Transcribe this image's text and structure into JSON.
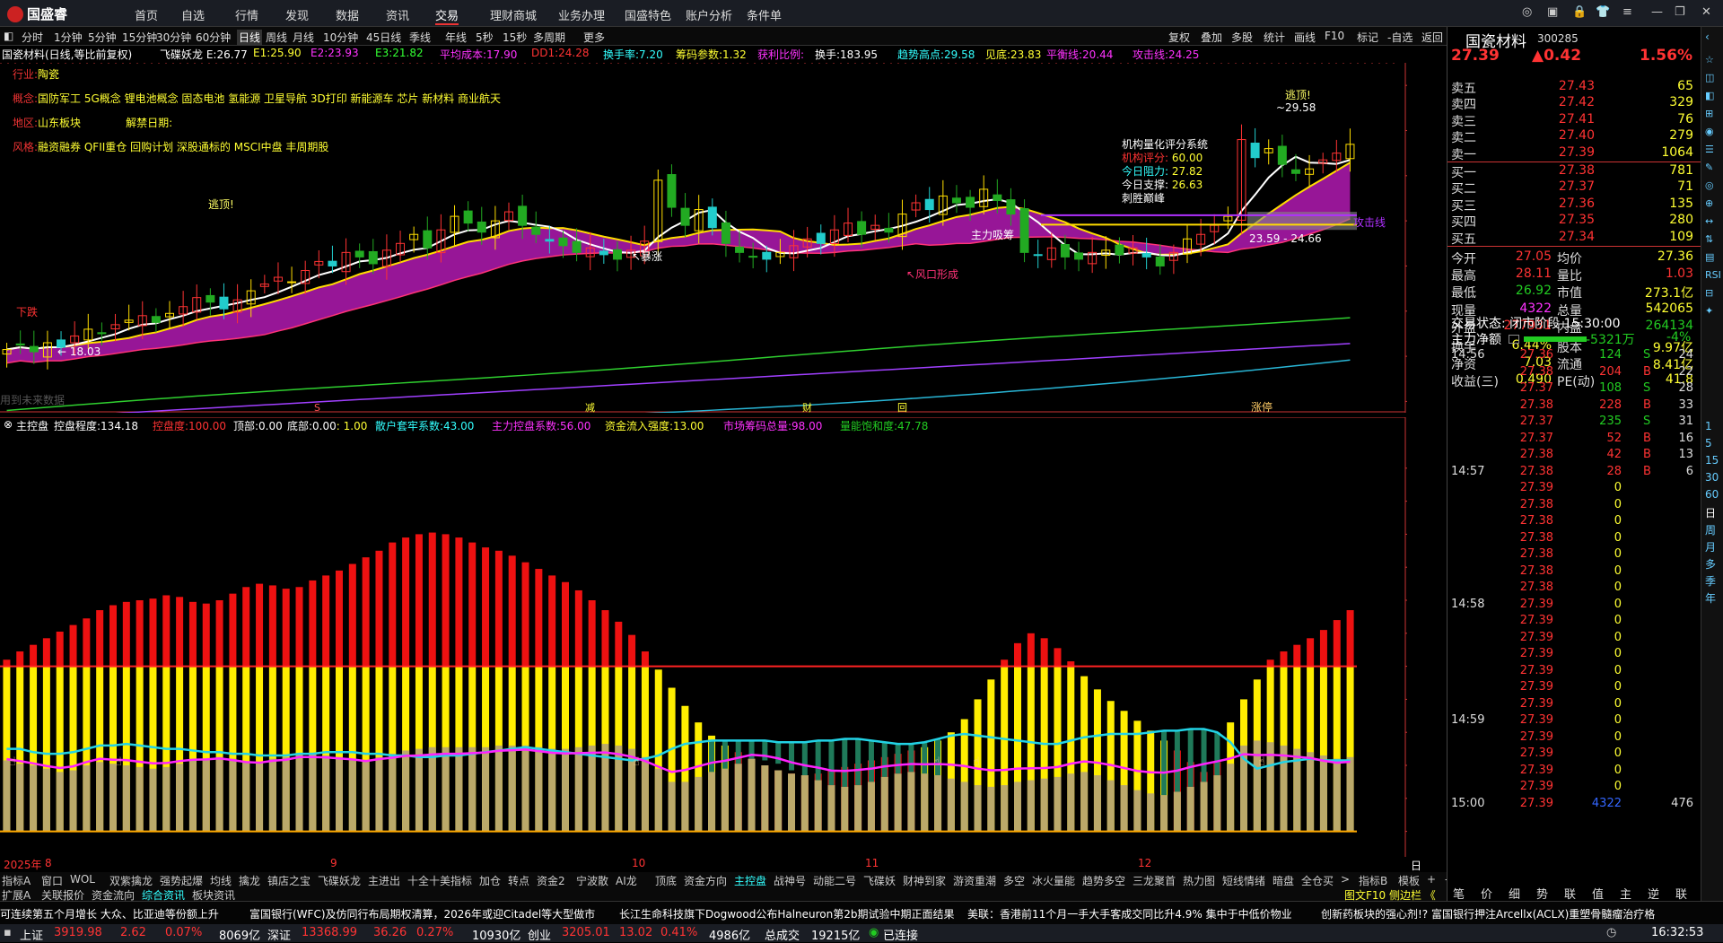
{
  "app": {
    "logo": "国盛睿"
  },
  "menu": [
    "首页",
    "自选",
    "行情",
    "发现",
    "数据",
    "资讯",
    "交易",
    "理财商城",
    "业务办理",
    "国盛特色",
    "账户分析",
    "条件单"
  ],
  "menu_active": "交易",
  "periods": [
    "分时",
    "1分钟",
    "5分钟",
    "15分钟",
    "30分钟",
    "60分钟",
    "日线",
    "周线",
    "月线",
    "10分钟",
    "45日线",
    "季线",
    "年线",
    "5秒",
    "15秒",
    "多周期",
    "更多"
  ],
  "period_active": "日线",
  "right_tools": [
    "复权",
    "叠加",
    "多股",
    "统计",
    "画线",
    "F10",
    "标记",
    "-自选",
    "返回"
  ],
  "kline_info": [
    {
      "t": "国瓷材料(日线,等比前复权)",
      "c": "#fff"
    },
    {
      "t": "飞碟妖龙 E:26.77",
      "c": "#fff"
    },
    {
      "t": "E1:25.90",
      "c": "#ff3"
    },
    {
      "t": "E2:23.93",
      "c": "#f3f"
    },
    {
      "t": "E3:21.82",
      "c": "#3f3"
    },
    {
      "t": "平均成本:17.90",
      "c": "#f3f"
    },
    {
      "t": "DD1:24.28",
      "c": "#f33"
    },
    {
      "t": "换手率:7.20",
      "c": "#3ff"
    },
    {
      "t": "筹码参数:1.32",
      "c": "#ff3"
    },
    {
      "t": "获利比例:",
      "c": "#f3f"
    },
    {
      "t": "换手:183.95",
      "c": "#fff"
    },
    {
      "t": "趋势高点:29.58",
      "c": "#3ff"
    },
    {
      "t": "见底:23.83",
      "c": "#ff3"
    },
    {
      "t": "平衡线:20.44",
      "c": "#f3f"
    },
    {
      "t": "攻击线:24.25",
      "c": "#f3f"
    }
  ],
  "stock_info": {
    "industry_label": "行业:",
    "industry": "陶瓷",
    "concept_label": "概念:",
    "concept": "国防军工 5G概念 锂电池概念 固态电池 氢能源 卫星导航 3D打印 新能源车 芯片 新材料 商业航天",
    "region_label": "地区:",
    "region": "山东板块",
    "unlock_label": "解禁日期:",
    "style_label": "风格:",
    "style": "融资融券 QFII重仓 回购计划 深股通标的 MSCI中盘 丰周期股"
  },
  "panel_box": {
    "title": "机构量化评分系统",
    "score_label": "机构评分:",
    "score": "60.00",
    "resist_label": "今日阻力:",
    "resist": "27.82",
    "support_label": "今日支撑:",
    "support": "26.63",
    "verdict": "刺胜巅峰"
  },
  "chart_labels": {
    "escape1": "逃顶!",
    "escape2": "逃顶!",
    "high": "29.58",
    "low": "18.03",
    "range": "23.59 - 24.66",
    "attack": "攻击线",
    "xiadie": "下跌",
    "zhuli": "主力吸筹",
    "fengkou": "风口形成",
    "zhangban": "涨停",
    "weidata": "用到未来数据",
    "breakout": "暴涨"
  },
  "chart_data": [
    {
      "type": "candlestick",
      "title": "国瓷材料(日线,等比前复权)",
      "ylim": [
        15.5,
        31
      ],
      "yticks": [
        16,
        18,
        20,
        22,
        24,
        26,
        28,
        30
      ],
      "close": [
        18.3,
        18.5,
        18.2,
        18.6,
        18.4,
        18.9,
        19.2,
        19.0,
        19.4,
        19.6,
        19.8,
        19.5,
        19.9,
        20.2,
        20.6,
        20.4,
        20.1,
        20.5,
        20.9,
        21.2,
        21.5,
        21.3,
        21.8,
        22.2,
        22.0,
        22.6,
        22.4,
        22.1,
        22.7,
        23.0,
        23.4,
        22.8,
        23.6,
        24.2,
        23.9,
        23.5,
        24.0,
        24.4,
        23.8,
        23.4,
        23.1,
        22.9,
        22.6,
        22.8,
        22.5,
        22.3,
        22.7,
        23.1,
        25.8,
        24.6,
        23.8,
        24.5,
        23.7,
        23.0,
        22.6,
        22.4,
        22.3,
        22.6,
        22.9,
        23.2,
        23.0,
        23.6,
        23.9,
        23.4,
        23.8,
        23.5,
        24.3,
        24.8,
        24.5,
        25.1,
        24.8,
        24.6,
        25.4,
        24.9,
        24.3,
        22.6,
        22.5,
        22.8,
        22.4,
        22.3,
        22.6,
        22.7,
        22.5,
        22.8,
        22.4,
        22.0,
        22.6,
        23.2,
        23.4,
        23.8,
        24.2,
        27.6,
        26.8,
        27.2,
        26.5,
        26.1,
        26.3,
        26.7,
        27.0,
        27.39
      ]
    },
    {
      "type": "bar",
      "title": "主控盘",
      "ylim": [
        -10,
        240
      ],
      "yticks": [
        0,
        20,
        40,
        60,
        80,
        100,
        120,
        140,
        160,
        180,
        200,
        220
      ],
      "series": [
        {
          "name": "控盘度",
          "values": [
            104,
            109,
            113,
            117,
            121,
            125,
            129,
            134,
            137,
            139,
            140,
            141,
            143,
            142,
            139,
            138,
            140,
            144,
            148,
            150,
            149,
            147,
            148,
            152,
            155,
            158,
            162,
            166,
            170,
            175,
            178,
            180,
            181,
            180,
            178,
            175,
            172,
            170,
            167,
            163,
            159,
            155,
            151,
            146,
            140,
            134,
            127,
            119,
            109,
            98,
            87,
            76,
            66,
            58,
            52,
            48,
            44,
            40,
            37,
            35,
            34,
            35,
            37,
            39,
            41,
            43,
            45,
            47,
            49,
            51,
            55,
            60,
            68,
            80,
            92,
            104,
            114,
            120,
            117,
            111,
            103,
            94,
            86,
            79,
            73,
            67,
            61,
            55,
            49,
            42,
            36,
            42,
            66,
            80,
            92,
            104,
            109,
            113,
            117,
            122,
            128,
            134
          ]
        },
        {
          "name": "散户套牢系数",
          "values": [
            50,
            50,
            48,
            47,
            47,
            48,
            50,
            52,
            52,
            53,
            52,
            51,
            50,
            50,
            49,
            48,
            48,
            47,
            47,
            46,
            46,
            46,
            47,
            47,
            48,
            48,
            48,
            47,
            47,
            46,
            46,
            45,
            45,
            46,
            46,
            47,
            48,
            49,
            50,
            51,
            50,
            49,
            48,
            47,
            46,
            45,
            44,
            43,
            44,
            46,
            50,
            53,
            54,
            55,
            55,
            55,
            55,
            55,
            54,
            54,
            54,
            55,
            55,
            56,
            56,
            55,
            54,
            53,
            53,
            54,
            56,
            58,
            59,
            58,
            57,
            56,
            55,
            54,
            53,
            53,
            55,
            57,
            58,
            59,
            59,
            59,
            60,
            61,
            61,
            62,
            62,
            60,
            54,
            44,
            38,
            40,
            42,
            43,
            44,
            43,
            43,
            43
          ]
        },
        {
          "name": "市场筹码总量",
          "values": [
            43,
            41,
            40,
            38,
            36,
            37,
            40,
            42,
            41,
            40,
            39,
            38,
            39,
            41,
            43,
            44,
            45,
            44,
            42,
            42,
            44,
            45,
            47,
            47,
            46,
            45,
            44,
            43,
            45,
            47,
            49,
            50,
            51,
            51,
            51,
            51,
            51,
            52,
            52,
            52,
            51,
            50,
            50,
            51,
            52,
            53,
            52,
            50,
            45,
            38,
            30,
            30,
            33,
            36,
            38,
            41,
            44,
            43,
            41,
            37,
            34,
            31,
            28,
            27,
            28,
            30,
            33,
            35,
            36,
            35,
            34,
            32,
            30,
            28,
            27,
            28,
            30,
            31,
            32,
            33,
            35,
            36,
            34,
            31,
            28,
            25,
            23,
            22,
            24,
            27,
            30,
            34,
            41,
            52,
            55,
            54,
            52,
            50,
            48,
            46,
            44,
            45
          ]
        }
      ],
      "labels": {
        "main": "主控盘",
        "kongpan_label": "控盘程度:",
        "kongpan": "134.18",
        "kpd_label": "控盘度:",
        "kpd": "100.00",
        "top_label": "顶部:",
        "top": "0.00",
        "bot_label": "底部:",
        "bot": "0.00",
        "ratio": ": 1.00",
        "sanhu_label": "散户套牢系数:",
        "sanhu": "43.00",
        "zhuli_label": "主力控盘系数:",
        "zhuli": "56.00",
        "inflow_label": "资金流入强度:",
        "inflow": "13.00",
        "chip_label": "市场筹码总量:",
        "chip": "98.00",
        "sat_label": "量能饱和度:",
        "sat": "47.78"
      }
    }
  ],
  "dates": [
    "2025年",
    "8",
    "9",
    "10",
    "11",
    "12"
  ],
  "bottom_tabs_row1": [
    "指标A",
    "窗口",
    "WOL",
    "双紫擒龙",
    "强势起爆",
    "均线",
    "擒龙",
    "镇店之宝",
    "飞碟妖龙",
    "主进出",
    "十全十美指标",
    "加仓",
    "转点",
    "资金2",
    "宁波散",
    "AI龙",
    "顶底",
    "资金方向",
    "主控盘",
    "战神号",
    "动能二号",
    "飞碟妖",
    "财神到家",
    "游资重潮",
    "多空",
    "冰火量能",
    "趋势多空",
    "三龙聚首",
    "热力图",
    "短线情绪",
    "暗盘",
    "全仓买",
    ">",
    "指标B",
    "模板",
    "+",
    "-"
  ],
  "bottom_tabs_row2": [
    "扩展A",
    "关联报价",
    "资金流向",
    "综合资讯",
    "板块资讯"
  ],
  "bottom_right_info": "图文F10 侧边栏 《",
  "news": [
    "可连续第五个月增长 大众、比亚迪等份额上升",
    "富国银行(WFC)及仿同行布局期权清算，2026年或迎Citadel等大型做市",
    "长江生命科技旗下Dogwood公布Halneuron第2b期试验中期正面结果",
    "美联：香港前11个月一手大手客成交同比升4.9% 集中于中低价物业",
    "创新药板块的强心剂!? 富国银行押注Arcellx(ACLX)重塑骨髓瘤治疗格"
  ],
  "status": {
    "sh_label": "上证",
    "sh": "3919.98",
    "sh_chg": "2.62",
    "sh_pct": "0.07%",
    "sh_amt": "8069亿",
    "sz_label": "深证",
    "sz": "13368.99",
    "sz_chg": "36.26",
    "sz_pct": "0.27%",
    "sz_amt": "10930亿",
    "cy_label": "创业",
    "cy": "3205.01",
    "cy_chg": "13.02",
    "cy_pct": "0.41%",
    "cy_amt": "4986亿",
    "total_label": "总成交",
    "total": "19215亿",
    "conn": "已连接",
    "time": "16:32:53"
  },
  "quote": {
    "name": "国瓷材料",
    "code": "300285",
    "price": "27.39",
    "change": "▲0.42",
    "pct": "1.56%",
    "asks": [
      {
        "l": "卖五",
        "p": "27.43",
        "v": "65"
      },
      {
        "l": "卖四",
        "p": "27.42",
        "v": "329"
      },
      {
        "l": "卖三",
        "p": "27.41",
        "v": "76"
      },
      {
        "l": "卖二",
        "p": "27.40",
        "v": "279"
      },
      {
        "l": "卖一",
        "p": "27.39",
        "v": "1064"
      }
    ],
    "bids": [
      {
        "l": "买一",
        "p": "27.38",
        "v": "781"
      },
      {
        "l": "买二",
        "p": "27.37",
        "v": "71"
      },
      {
        "l": "买三",
        "p": "27.36",
        "v": "135"
      },
      {
        "l": "买四",
        "p": "27.35",
        "v": "280"
      },
      {
        "l": "买五",
        "p": "27.34",
        "v": "109"
      }
    ],
    "stats": [
      [
        "今开",
        "27.05",
        "均价",
        "27.36"
      ],
      [
        "最高",
        "28.11",
        "量比",
        "1.03"
      ],
      [
        "最低",
        "26.92",
        "市值",
        "273.1亿"
      ],
      [
        "现量",
        "4322",
        "总量",
        "542065"
      ],
      [
        "外盘",
        "277931",
        "内盘",
        "264134"
      ]
    ],
    "stats2": [
      [
        "换手",
        "6.44%",
        "股本",
        "9.97亿"
      ],
      [
        "净资",
        "7.03",
        "流通",
        "8.41亿"
      ],
      [
        "收益(三)",
        "0.490",
        "PE(动)",
        "41.8"
      ]
    ],
    "state": "交易状态: 闭市阶段 15:30:00",
    "netflow_label": "主力净额",
    "netflow": "-5321万",
    "netflow_pct": "-4%"
  },
  "ticks": [
    [
      "14:56",
      "27.36",
      "124",
      "S",
      "24"
    ],
    [
      "",
      "27.38",
      "204",
      "B",
      "22"
    ],
    [
      "",
      "27.37",
      "108",
      "S",
      "28"
    ],
    [
      "",
      "27.38",
      "228",
      "B",
      "33"
    ],
    [
      "",
      "27.37",
      "235",
      "S",
      "31"
    ],
    [
      "",
      "27.37",
      "52",
      "B",
      "16"
    ],
    [
      "",
      "27.38",
      "42",
      "B",
      "13"
    ],
    [
      "14:57",
      "27.38",
      "28",
      "B",
      "6"
    ],
    [
      "",
      "27.39",
      "0",
      "",
      ""
    ],
    [
      "",
      "27.38",
      "0",
      "",
      ""
    ],
    [
      "",
      "27.38",
      "0",
      "",
      ""
    ],
    [
      "",
      "27.38",
      "0",
      "",
      ""
    ],
    [
      "",
      "27.38",
      "0",
      "",
      ""
    ],
    [
      "",
      "27.38",
      "0",
      "",
      ""
    ],
    [
      "",
      "27.38",
      "0",
      "",
      ""
    ],
    [
      "14:58",
      "27.39",
      "0",
      "",
      ""
    ],
    [
      "",
      "27.39",
      "0",
      "",
      ""
    ],
    [
      "",
      "27.39",
      "0",
      "",
      ""
    ],
    [
      "",
      "27.39",
      "0",
      "",
      ""
    ],
    [
      "",
      "27.39",
      "0",
      "",
      ""
    ],
    [
      "",
      "27.39",
      "0",
      "",
      ""
    ],
    [
      "",
      "27.39",
      "0",
      "",
      ""
    ],
    [
      "14:59",
      "27.39",
      "0",
      "",
      ""
    ],
    [
      "",
      "27.39",
      "0",
      "",
      ""
    ],
    [
      "",
      "27.39",
      "0",
      "",
      ""
    ],
    [
      "",
      "27.39",
      "0",
      "",
      ""
    ],
    [
      "",
      "27.39",
      "0",
      "",
      ""
    ],
    [
      "15:00",
      "27.39",
      "4322",
      "",
      "476"
    ]
  ],
  "right_bottom_tabs": [
    "笔",
    "价",
    "细",
    "势",
    "联",
    "值",
    "主",
    "逆",
    "联"
  ],
  "sidebar": [
    "1",
    "5",
    "15",
    "30",
    "60",
    "日",
    "周",
    "月",
    "多",
    "季",
    "年"
  ]
}
